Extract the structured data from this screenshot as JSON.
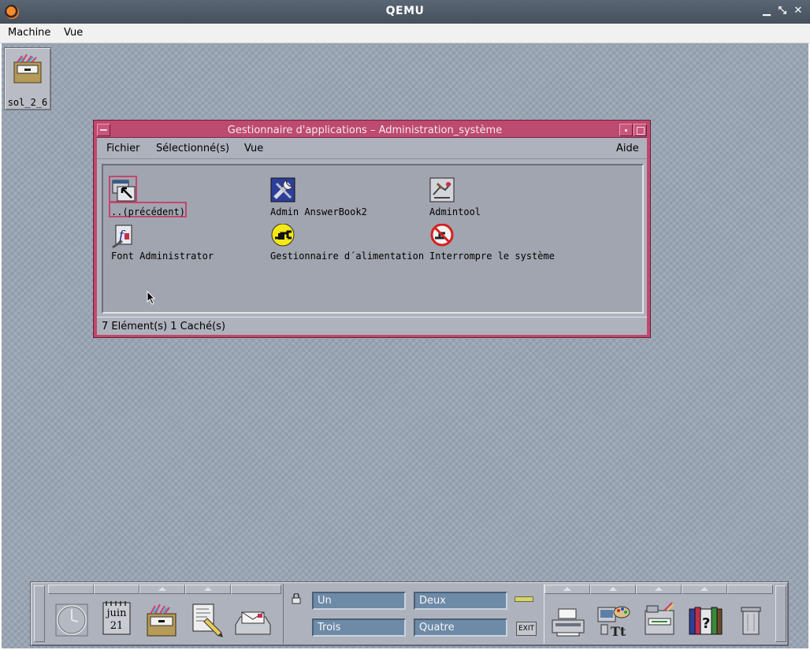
{
  "host": {
    "title": "QEMU",
    "menu": [
      "Machine",
      "Vue"
    ],
    "controls": [
      "minimize-icon",
      "restore-icon",
      "close-icon"
    ]
  },
  "desktop": {
    "icon_label": "sol_2_6"
  },
  "window": {
    "title": "Gestionnaire d'applications – Administration_système",
    "menu": {
      "file": "Fichier",
      "selected": "Sélectionné(s)",
      "view": "Vue",
      "help": "Aide"
    },
    "items": [
      {
        "label": "..(précédent)",
        "icon": "parent-folder-icon"
      },
      {
        "label": "Admin AnswerBook2",
        "icon": "answerbook-tools-icon"
      },
      {
        "label": "Admintool",
        "icon": "admintool-icon"
      },
      {
        "label": "Font Administrator",
        "icon": "font-admin-icon"
      },
      {
        "label": "Gestionnaire d´alimentation",
        "icon": "power-manager-icon"
      },
      {
        "label": "Interrompre le système",
        "icon": "shutdown-icon"
      }
    ],
    "status": "7 Elément(s) 1 Caché(s)"
  },
  "frontpanel": {
    "calendar_month": "juin",
    "calendar_day": "21",
    "workspaces": [
      "Un",
      "Deux",
      "Trois",
      "Quatre"
    ],
    "exit_label": "EXIT"
  }
}
